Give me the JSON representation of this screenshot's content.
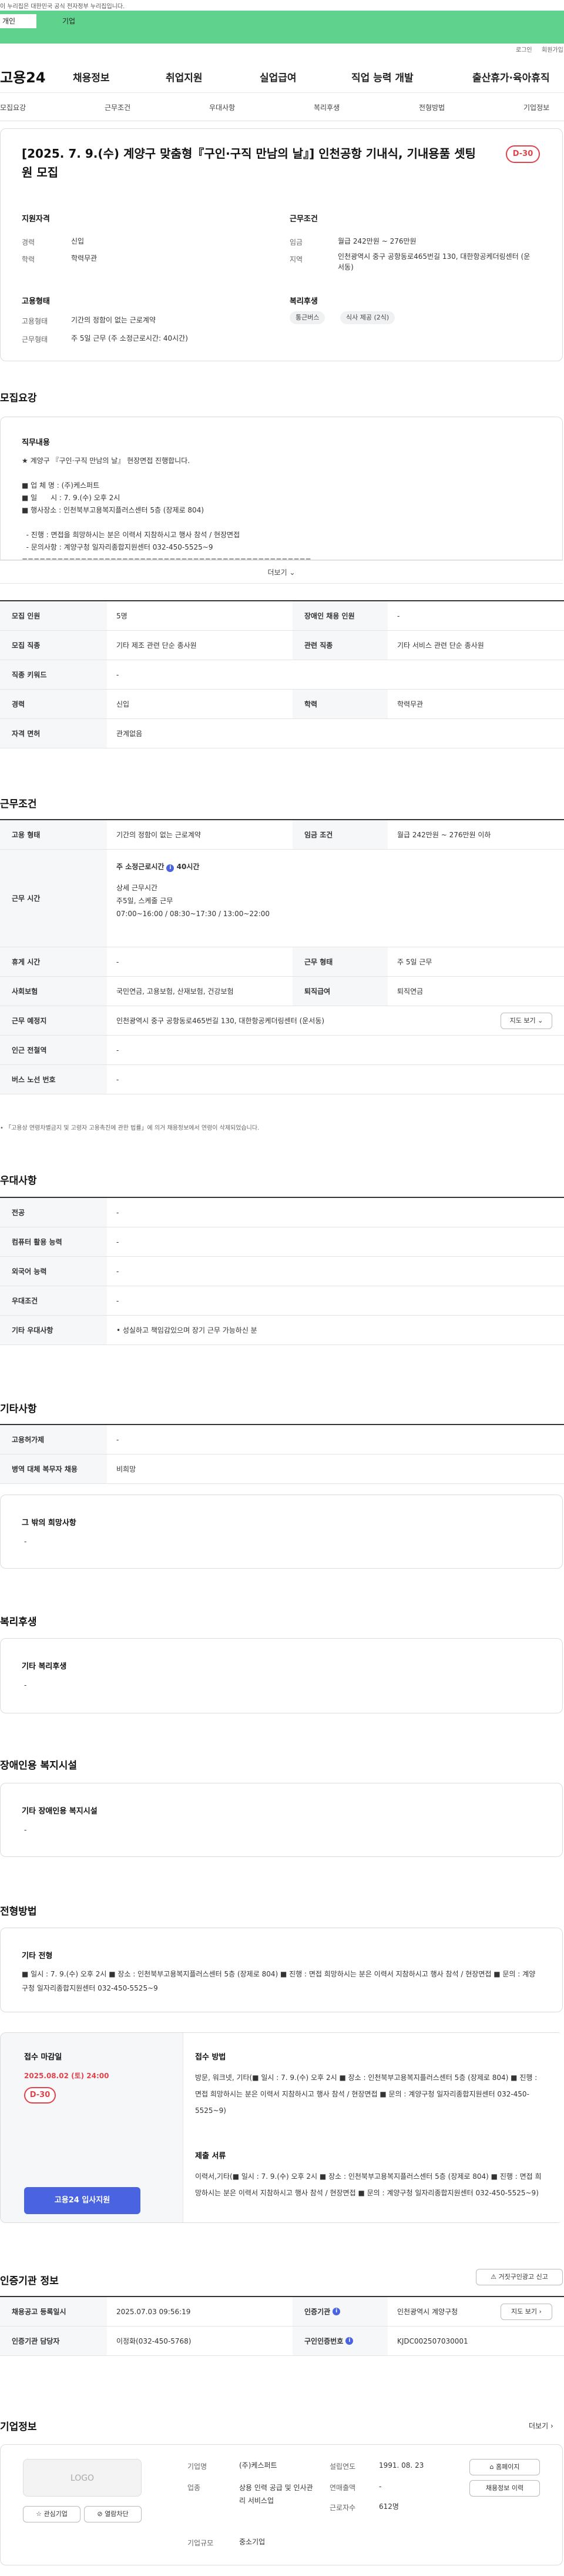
{
  "gov_banner": "이 누리집은 대한민국 공식 전자정부 누리집입니다.",
  "user_tabs": [
    "개인",
    "기업"
  ],
  "util": {
    "login": "로그인",
    "signup": "회원가입"
  },
  "logo": "고용24",
  "gnb": [
    "채용정보",
    "취업지원",
    "실업급여",
    "직업 능력 개발",
    "출산휴가·육아휴직"
  ],
  "tabs": [
    "모집요강",
    "근무조건",
    "우대사항",
    "복리후생",
    "전형방법",
    "기업정보"
  ],
  "summary": {
    "title": "[2025. 7. 9.(수) 계양구 맞춤형『구인·구직 만남의 날』] 인천공항 기내식, 기내용품 셋팅원 모집",
    "dday": "D-30",
    "qual_h": "지원자격",
    "career_l": "경력",
    "career_v": "신입",
    "edu_l": "학력",
    "edu_v": "학력무관",
    "cond_h": "근무조건",
    "wage_l": "임금",
    "wage_v": "월급 242만원 ~ 276만원",
    "area_l": "지역",
    "area_v": "인천광역시 중구 공항동로465번길 130, 대한항공케더링센터 (운서동)",
    "emp_h": "고용형태",
    "emptype_l": "고용형태",
    "emptype_v": "기간의 정함이 없는 근로계약",
    "hours_l": "근무형태",
    "hours_v": "주 5일 근무 (주 소정근로시간: 40시간)",
    "welfare_h": "복리후생",
    "welfare_chips": [
      "통근버스",
      "식사 제공 (2식)"
    ]
  },
  "recruit": {
    "heading": "모집요강",
    "duty_h": "직무내용",
    "duty_text": "★ 계양구 『구인·구직 만남의 날』 현장면접 진행합니다.\n\n■ 업 체 명 : (주)케스퍼트\n■ 일      시 : 7. 9.(수) 오후 2시\n■ 행사장소 : 인천북부고용복지플러스센터 5층 (장제로 804)\n\n  - 진행 : 면접을 희망하시는 분은 이력서 지참하시고 행사 참석 / 현장면접\n  - 문의사항 : 계양구청 일자리종합지원센터 032-450-5525~9\n=================================================",
    "more": "더보기",
    "rows": [
      [
        "모집 인원",
        "5명",
        "장애인 채용 인원",
        "-"
      ],
      [
        "모집 직종",
        "기타 제조 관련 단순 종사원",
        "관련 직종",
        "기타 서비스 관련 단순 종사원"
      ],
      [
        "직종 키워드",
        "-"
      ],
      [
        "경력",
        "신입",
        "학력",
        "학력무관"
      ],
      [
        "자격 면허",
        "관계없음"
      ]
    ]
  },
  "work": {
    "heading": "근무조건",
    "type_l": "고용 형태",
    "type_v": "기간의 정함이 없는 근로계약",
    "wage_l": "임금 조건",
    "wage_v": "월급 242만원 ~ 276만원 이하",
    "time_l": "근무 시간",
    "time_main": "주 소정근로시간",
    "time_hours": "40시간",
    "time_sub": "상세 근무시간",
    "time_d1": "주5일, 스케줄 근무",
    "time_d2": "07:00~16:00 / 08:30~17:30 / 13:00~22:00",
    "holiday_l": "휴게 시간",
    "holiday_v": "-",
    "worktype_l": "근무 형태",
    "worktype_v": "주 5일 근무",
    "ins_l": "사회보험",
    "ins_v": "국민연금, 고용보험, 산재보험, 건강보험",
    "sev_l": "퇴직급여",
    "sev_v": "퇴직연금",
    "place_l": "근무 예정지",
    "place_v": "인천광역시 중구 공항동로465번길 130, 대한항공케더링센터 (운서동)",
    "map_btn": "지도 보기",
    "subway_l": "인근 전철역",
    "subway_v": "-",
    "bus_l": "버스 노선 번호",
    "bus_v": "-",
    "note": "• 「고용상 연령차별금지 및 고령자 고용촉진에 관한 법률」에 의거 채용정보에서 연령이 삭제되었습니다."
  },
  "pref": {
    "heading": "우대사항",
    "rows": [
      [
        "전공",
        "-"
      ],
      [
        "컴퓨터 활용 능력",
        "-"
      ],
      [
        "외국어 능력",
        "-"
      ],
      [
        "우대조건",
        "-"
      ],
      [
        "기타 우대사항",
        "• 성실하고 책임감있으며 장기 근무 가능하신 분"
      ]
    ]
  },
  "etc": {
    "heading": "기타사항",
    "rows": [
      [
        "고용허가제",
        "-"
      ],
      [
        "병역 대체 복무자 채용",
        "비희망"
      ]
    ],
    "other_h": "그 밖의 희망사항",
    "other_v": "-"
  },
  "welfare": {
    "heading": "복리후생",
    "box_h": "기타 복리후생",
    "box_v": "-"
  },
  "disabled": {
    "heading": "장애인용 복지시설",
    "box_h": "기타 장애인용 복지시설",
    "box_v": "-"
  },
  "screen": {
    "heading": "전형방법",
    "box_h": "기타 전형",
    "box_v": "■ 일시 : 7. 9.(수) 오후 2시 ■ 장소 : 인천북부고용복지플러스센터 5층 (장제로 804) ■ 진행 : 면접 희망하시는 분은 이력서 지참하시고 행사 참석 / 현장면접 ■ 문의 : 계양구청 일자리종합지원센터 032-450-5525~9",
    "deadline_h": "접수 마감일",
    "deadline_v": "2025.08.02 (토) 24:00",
    "dday": "D-30",
    "apply_btn": "고용24 입사지원",
    "method_h": "접수 방법",
    "method_v": "방문, 워크넷, 기타(■ 일시 : 7. 9.(수) 오후 2시 ■ 장소 : 인천북부고용복지플러스센터 5층 (장제로 804) ■ 진행 : 면접 희망하시는 분은 이력서 지참하시고 행사 참석 / 현장면접 ■ 문의 : 계양구청 일자리종합지원센터 032-450-5525~9)",
    "docs_h": "제출 서류",
    "docs_v": "이력서,기타(■ 일시 : 7. 9.(수) 오후 2시 ■ 장소 : 인천북부고용복지플러스센터 5층 (장제로 804) ■ 진행 : 면접 희망하시는 분은 이력서 지참하시고 행사 참석 / 현장면접 ■ 문의 : 계양구청 일자리종합지원센터 032-450-5525~9)"
  },
  "cert": {
    "heading": "인증기관 정보",
    "report_btn": "거짓구인광고 신고",
    "rows": [
      [
        "채용공고 등록일시",
        "2025.07.03 09:56:19",
        "인증기관",
        "인천광역시 계양구청"
      ],
      [
        "인증기관 담당자",
        "이정화(032-450-5768)",
        "구인인증번호",
        "KJDC002507030001"
      ]
    ],
    "map_btn": "지도 보기"
  },
  "company": {
    "heading": "기업정보",
    "more": "더보기",
    "logo": "LOGO",
    "interest": "관심기업",
    "block": "열람차단",
    "name_l": "기업명",
    "name_v": "(주)케스퍼트",
    "est_l": "설립연도",
    "est_v": "1991. 08. 23",
    "ind_l": "업종",
    "ind_v": "상용 인력 공급 및 인사관리 서비스업",
    "sales_l": "연매출액",
    "sales_v": "-",
    "emp_l": "근로자수",
    "emp_v": "612명",
    "size_l": "기업규모",
    "size_v": "중소기업",
    "home_btn": "홈페이지",
    "job_btn": "채용정보 이력"
  }
}
